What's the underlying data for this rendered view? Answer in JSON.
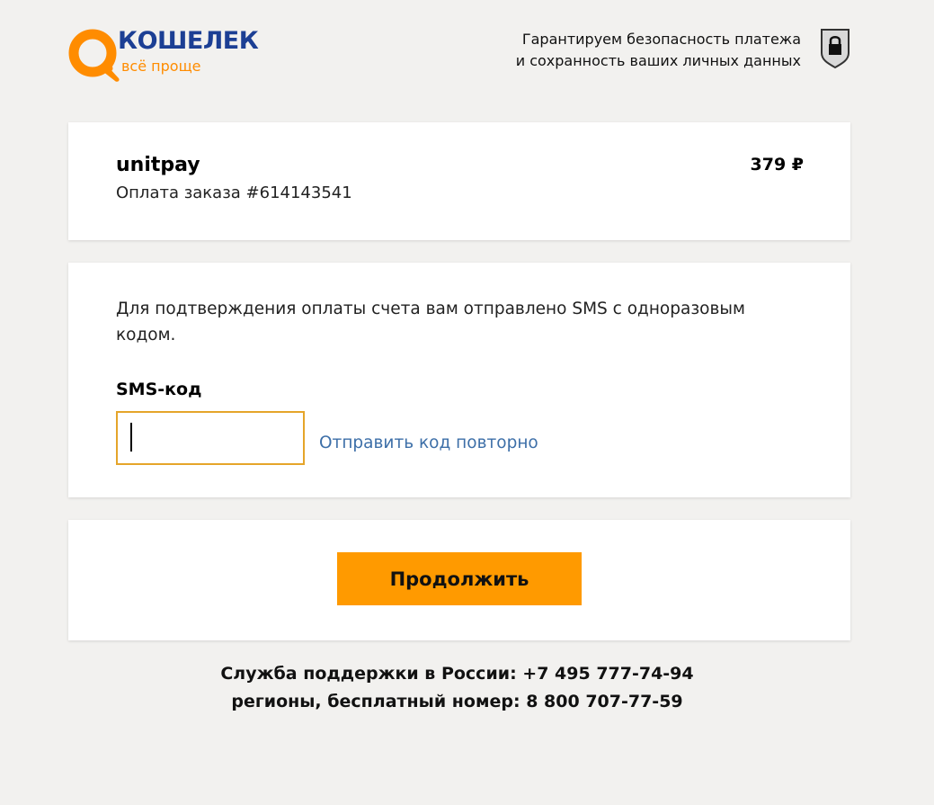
{
  "header": {
    "logo_title": "КОШЕЛЕК",
    "logo_tagline": "всё проще",
    "guarantee_line1": "Гарантируем безопасность платежа",
    "guarantee_line2": "и сохранность ваших личных данных",
    "shield_icon": "shield-lock-icon"
  },
  "order": {
    "merchant": "unitpay",
    "description": "Оплата заказа #614143541",
    "amount": "379 ₽"
  },
  "sms": {
    "info": "Для подтверждения оплаты счета вам отправлено SMS с одноразовым кодом.",
    "label": "SMS-код",
    "input_value": "",
    "resend_link": "Отправить код повторно"
  },
  "submit": {
    "label": "Продолжить"
  },
  "support": {
    "line1": "Служба поддержки в России: +7 495 777-74-94",
    "line2": "регионы, бесплатный номер: 8 800 707-77-59"
  },
  "colors": {
    "background": "#f2f1ef",
    "brand_blue": "#1c3f94",
    "brand_orange": "#ff8c00",
    "button": "#ff9a00",
    "input_border": "#e5a52a",
    "link": "#3d6fa8"
  }
}
